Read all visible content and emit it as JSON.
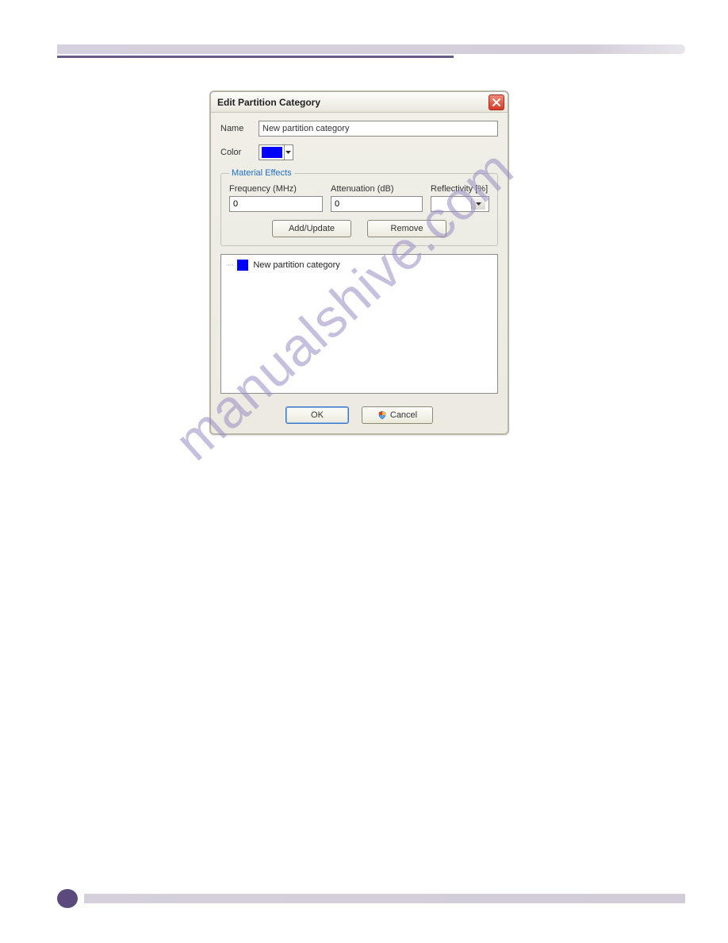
{
  "dialog": {
    "title": "Edit Partition Category",
    "name_label": "Name",
    "name_value": "New partition category",
    "color_label": "Color",
    "color_hex": "#0000ff",
    "material_effects": {
      "legend": "Material Effects",
      "frequency_label": "Frequency (MHz)",
      "frequency_value": "0",
      "attenuation_label": "Attenuation (dB)",
      "attenuation_value": "0",
      "reflectivity_label": "Reflectivity [%]",
      "reflectivity_value": "",
      "add_update_label": "Add/Update",
      "remove_label": "Remove"
    },
    "list": {
      "items": [
        {
          "label": "New partition category",
          "color": "#0000ff"
        }
      ]
    },
    "ok_label": "OK",
    "cancel_label": "Cancel"
  },
  "watermark_text": "manualshive.com"
}
